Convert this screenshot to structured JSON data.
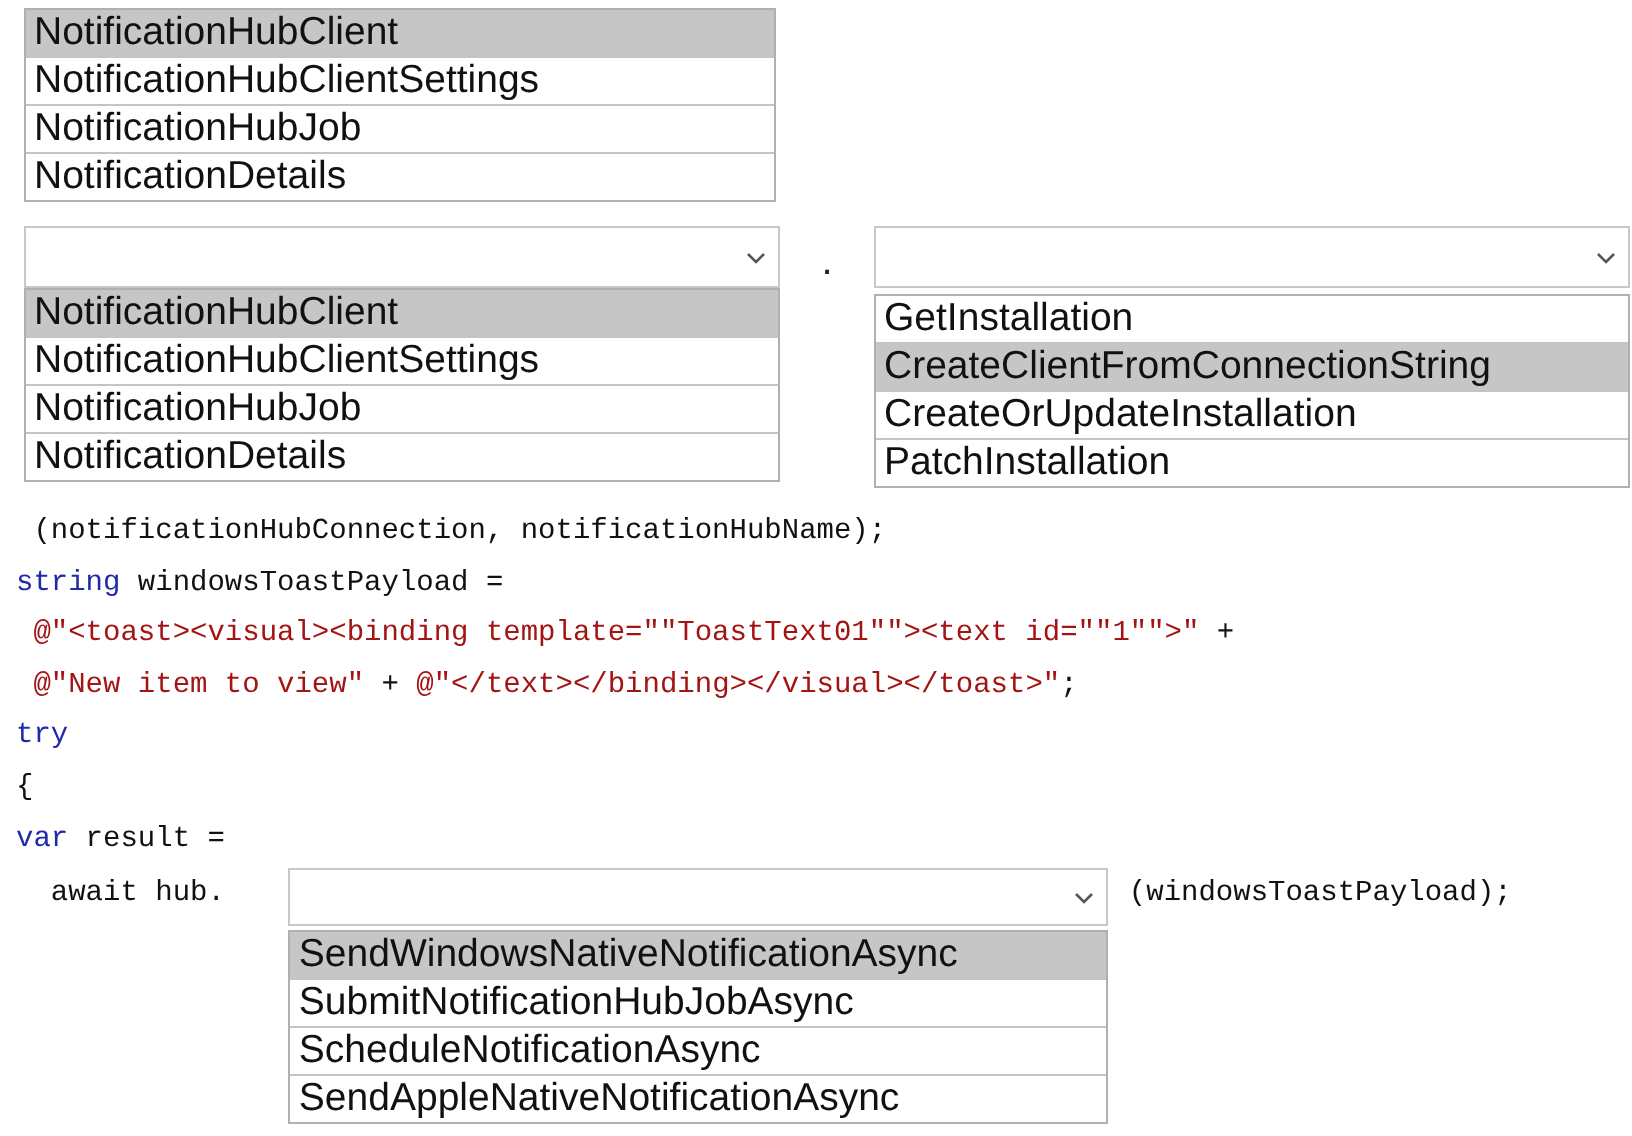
{
  "answer_list": {
    "items": [
      {
        "label": "NotificationHubClient",
        "selected": true
      },
      {
        "label": "NotificationHubClientSettings",
        "selected": false
      },
      {
        "label": "NotificationHubJob",
        "selected": false
      },
      {
        "label": "NotificationDetails",
        "selected": false
      }
    ]
  },
  "member_row": {
    "left_dropdown": {
      "options": [
        {
          "label": "NotificationHubClient",
          "selected": true
        },
        {
          "label": "NotificationHubClientSettings",
          "selected": false
        },
        {
          "label": "NotificationHubJob",
          "selected": false
        },
        {
          "label": "NotificationDetails",
          "selected": false
        }
      ]
    },
    "separator": ".",
    "right_dropdown": {
      "options": [
        {
          "label": "GetInstallation",
          "selected": false
        },
        {
          "label": "CreateClientFromConnectionString",
          "selected": true
        },
        {
          "label": "CreateOrUpdateInstallation",
          "selected": false
        },
        {
          "label": "PatchInstallation",
          "selected": false
        }
      ]
    }
  },
  "code_lines": [
    {
      "segments": [
        {
          "text": " (notificationHubConnection, notificationHubName);",
          "kind": "plain"
        }
      ]
    },
    {
      "segments": [
        {
          "text": "string",
          "kind": "keyword"
        },
        {
          "text": " windowsToastPayload =",
          "kind": "plain"
        }
      ]
    },
    {
      "segments": [
        {
          "text": " @\"<toast><visual><binding template=\"\"ToastText01\"\"><text id=\"\"1\"\">\"",
          "kind": "string"
        },
        {
          "text": " +",
          "kind": "plain"
        }
      ]
    },
    {
      "segments": [
        {
          "text": " @\"New item to view\"",
          "kind": "string"
        },
        {
          "text": " + ",
          "kind": "plain"
        },
        {
          "text": "@\"</text></binding></visual></toast>\"",
          "kind": "string"
        },
        {
          "text": ";",
          "kind": "plain"
        }
      ]
    },
    {
      "segments": [
        {
          "text": "try",
          "kind": "keyword"
        }
      ]
    },
    {
      "segments": [
        {
          "text": "{",
          "kind": "plain"
        }
      ]
    },
    {
      "segments": [
        {
          "text": "var",
          "kind": "keyword"
        },
        {
          "text": " result =",
          "kind": "plain"
        }
      ]
    }
  ],
  "call_line": {
    "before": "  await hub.",
    "dropdown": {
      "options": [
        {
          "label": "SendWindowsNativeNotificationAsync",
          "selected": true
        },
        {
          "label": "SubmitNotificationHubJobAsync",
          "selected": false
        },
        {
          "label": "ScheduleNotificationAsync",
          "selected": false
        },
        {
          "label": "SendAppleNativeNotificationAsync",
          "selected": false
        }
      ]
    },
    "after": "(windowsToastPayload);"
  }
}
